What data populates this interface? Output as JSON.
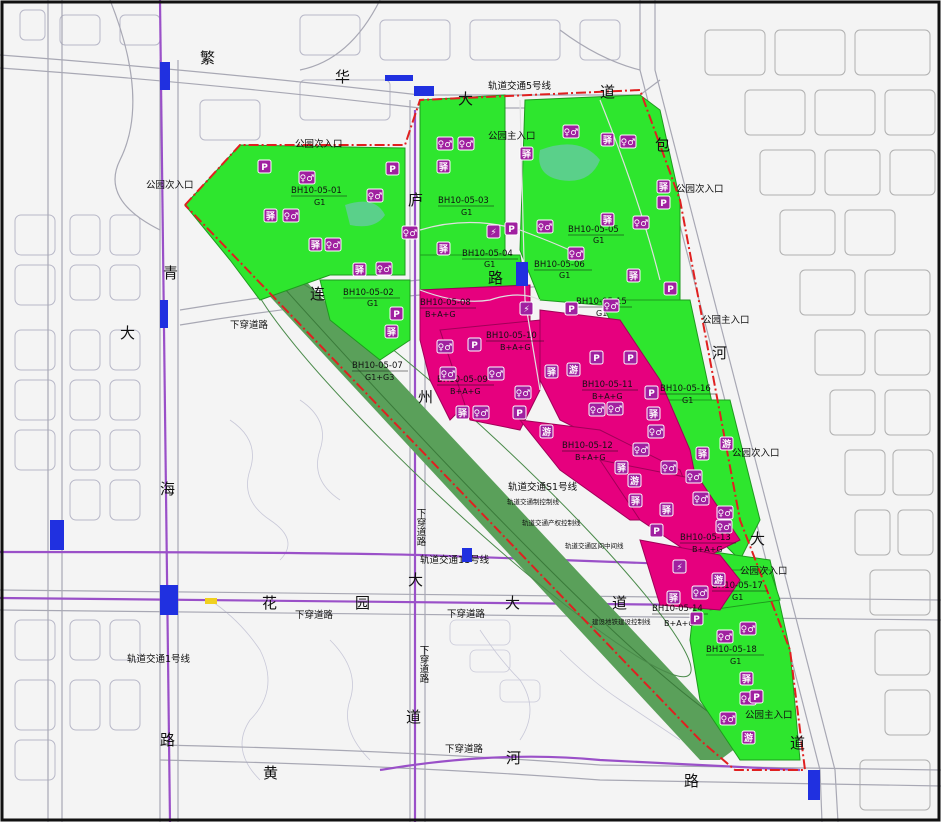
{
  "roads": {
    "fanhua": "繁华大道",
    "bao": "包河大道",
    "qinghai": "青海大路",
    "huangheroad": "黄河路",
    "huayuan": "花园大道",
    "luzhou": "庐州大道",
    "lianlu": "连路"
  },
  "road_chars": {
    "fan": "繁",
    "hua": "华",
    "da1": "大",
    "dao1": "道",
    "bao": "包",
    "he": "河",
    "da2": "大",
    "dao2": "道",
    "qing": "青",
    "da3": "大",
    "hai": "海",
    "lu1": "路",
    "huang": "黄",
    "he2": "河",
    "lu2": "路",
    "hua2": "花",
    "yuan": "园",
    "da4": "大",
    "dao3": "道",
    "lu3": "庐",
    "lu4": "路",
    "zhou": "州",
    "da5": "大",
    "dao4": "道",
    "lian": "连"
  },
  "labels": {
    "metro5": "轨道交通5号线",
    "metro1": "轨道交通1号线",
    "metro11": "轨道交通11号线",
    "metroS1": "轨道交通S1号线",
    "underpass1": "下穿道路",
    "underpass2": "下穿道路",
    "underpass3": "下穿道路",
    "underpass4": "下穿道路",
    "underpass_v1": "下穿道路",
    "underpass_v2": "下穿道路",
    "park_main_n": "公园主入口",
    "park_main_e": "公园主入口",
    "park_main_se": "公园主入口",
    "park_sec_nw": "公园次入口",
    "park_sec_w": "公园次入口",
    "park_sec_ne": "公园次入口",
    "park_sec_e": "公园次入口",
    "park_sec_se": "公园次入口",
    "ctrl1": "轨道交通制控制线",
    "ctrl2": "轨道交通产权控制线",
    "ctrl3": "轨道交通区间中间线",
    "ctrl4": "建设地铁建设控制线"
  },
  "plots": [
    {
      "id": "BH10-05-01",
      "code": "G1"
    },
    {
      "id": "BH10-05-02",
      "code": "G1"
    },
    {
      "id": "BH10-05-03",
      "code": "G1"
    },
    {
      "id": "BH10-05-04",
      "code": "G1"
    },
    {
      "id": "BH10-05-05",
      "code": "G1"
    },
    {
      "id": "BH10-05-06",
      "code": "G1"
    },
    {
      "id": "BH10-05-07",
      "code": "G1+G3"
    },
    {
      "id": "BH10-05-08",
      "code": "B+A+G"
    },
    {
      "id": "BH10-05-09",
      "code": "B+A+G"
    },
    {
      "id": "BH10-05-10",
      "code": "B+A+G"
    },
    {
      "id": "BH10-05-11",
      "code": "B+A+G"
    },
    {
      "id": "BH10-05-12",
      "code": "B+A+G"
    },
    {
      "id": "BH10-05-13",
      "code": "B+A+G"
    },
    {
      "id": "BH10-05-14",
      "code": "B+A+G"
    },
    {
      "id": "BH10-05-15",
      "code": "G1"
    },
    {
      "id": "BH10-05-16",
      "code": "G1"
    },
    {
      "id": "BH10-05-17",
      "code": "G1"
    },
    {
      "id": "BH10-05-18",
      "code": "G1"
    }
  ],
  "icons": {
    "parking": "P",
    "toilet": "♀♂",
    "station": "驿",
    "tour": "游",
    "charge": "⚡"
  },
  "colors": {
    "green_space": "#2ee62e",
    "commercial": "#e6007e",
    "rail_band": "#5aa05a",
    "boundary": "#e02020",
    "metro_line": "#9a50c8",
    "icon_purple": "#a020a0"
  }
}
